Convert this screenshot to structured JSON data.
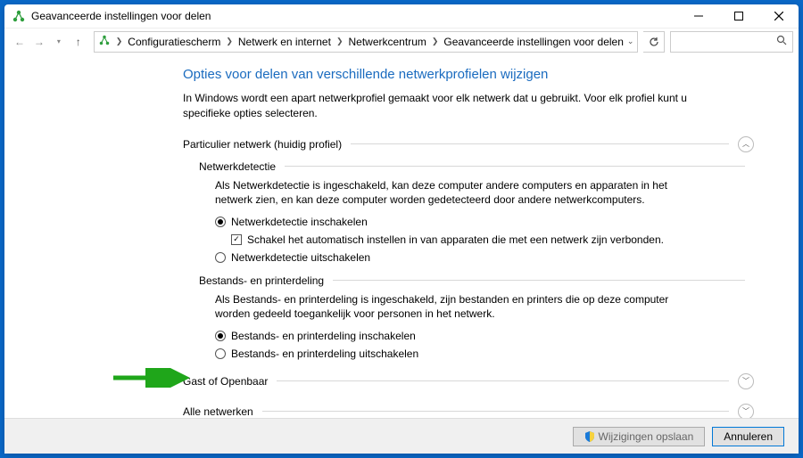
{
  "window_title": "Geavanceerde instellingen voor delen",
  "breadcrumbs": [
    "Configuratiescherm",
    "Netwerk en internet",
    "Netwerkcentrum",
    "Geavanceerde instellingen voor delen"
  ],
  "heading": "Opties voor delen van verschillende netwerkprofielen wijzigen",
  "intro": "In Windows wordt een apart netwerkprofiel gemaakt voor elk netwerk dat u gebruikt. Voor elk profiel kunt u specifieke opties selecteren.",
  "profile_private": {
    "title": "Particulier netwerk (huidig profiel)",
    "network_discovery": {
      "title": "Netwerkdetectie",
      "desc": "Als Netwerkdetectie is ingeschakeld, kan deze computer andere computers en apparaten in het netwerk zien, en kan deze computer worden gedetecteerd door andere netwerkcomputers.",
      "opt_on": "Netwerkdetectie inschakelen",
      "opt_auto": "Schakel het automatisch instellen in van apparaten die met een netwerk zijn verbonden.",
      "opt_off": "Netwerkdetectie uitschakelen"
    },
    "file_sharing": {
      "title": "Bestands- en printerdeling",
      "desc": "Als Bestands- en printerdeling is ingeschakeld, zijn bestanden en printers die op deze computer worden gedeeld toegankelijk voor personen in het netwerk.",
      "opt_on": "Bestands- en printerdeling inschakelen",
      "opt_off": "Bestands- en printerdeling uitschakelen"
    }
  },
  "profile_guest": "Gast of Openbaar",
  "profile_all": "Alle netwerken",
  "buttons": {
    "save": "Wijzigingen opslaan",
    "cancel": "Annuleren"
  }
}
